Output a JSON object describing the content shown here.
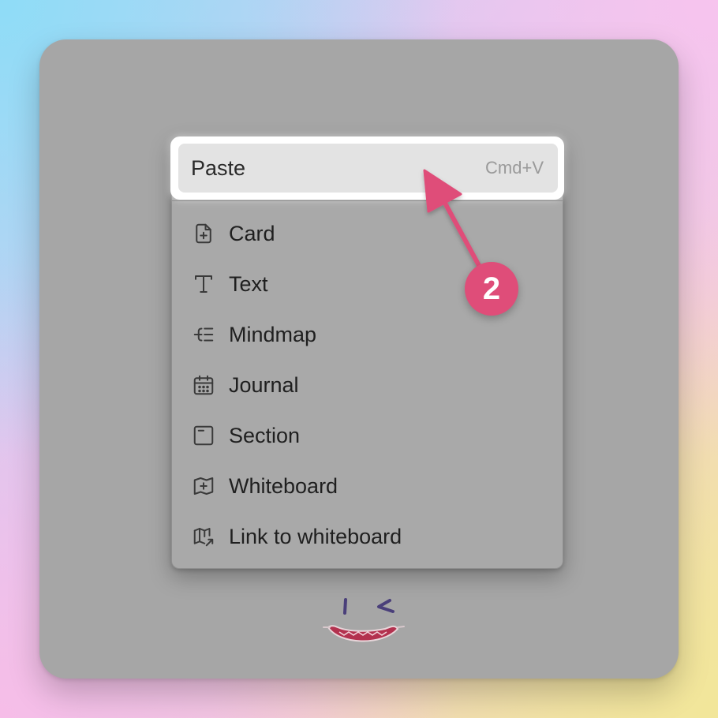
{
  "context_menu": {
    "paste": {
      "label": "Paste",
      "shortcut": "Cmd+V"
    },
    "items": [
      {
        "label": "Card",
        "icon": "card-add-icon"
      },
      {
        "label": "Text",
        "icon": "text-icon"
      },
      {
        "label": "Mindmap",
        "icon": "mindmap-icon"
      },
      {
        "label": "Journal",
        "icon": "calendar-icon"
      },
      {
        "label": "Section",
        "icon": "section-icon"
      },
      {
        "label": "Whiteboard",
        "icon": "whiteboard-add-icon"
      },
      {
        "label": "Link to whiteboard",
        "icon": "whiteboard-link-icon"
      }
    ]
  },
  "annotation": {
    "step_number": "2",
    "color": "#df4d79"
  },
  "colors": {
    "canvas": "#a6a6a6",
    "highlight": "#e3e3e3"
  }
}
